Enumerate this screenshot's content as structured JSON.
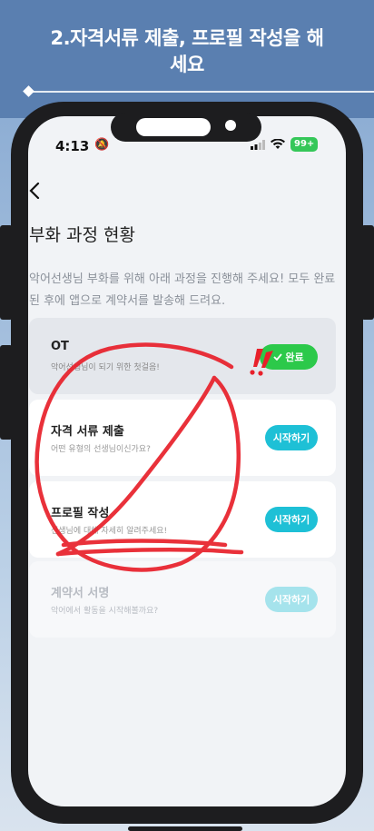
{
  "heading": {
    "line1": "2.자격서류 제출, 프로필 작성을 해",
    "line2": "세요"
  },
  "status_bar": {
    "time": "4:13",
    "battery": "99+"
  },
  "screen": {
    "back_icon": "chevron-left-icon",
    "title": "부화 과정 현황",
    "description": "악어선생님 부화를 위해 아래 과정을 진행해 주세요! 모두 완료된 후에 앱으로 계약서를 발송해 드려요."
  },
  "steps": [
    {
      "title": "OT",
      "subtitle": "악어선생님이 되기 위한 첫걸음!",
      "button": "완료",
      "state": "done"
    },
    {
      "title": "자격 서류 제출",
      "subtitle": "어떤 유형의 선생님이신가요?",
      "button": "시작하기",
      "state": "active"
    },
    {
      "title": "프로필 작성",
      "subtitle": "선생님에 대해 자세히 알려주세요!",
      "button": "시작하기",
      "state": "active"
    },
    {
      "title": "계약서 서명",
      "subtitle": "악어에서 활동을 시작해볼까요?",
      "button": "시작하기",
      "state": "disabled"
    }
  ],
  "colors": {
    "background": "#c3d6e8",
    "primary": "#1ec0d6",
    "done_green": "#2cc94a",
    "annotation_red": "#e8202a",
    "phone_frame": "#1d1d1f"
  }
}
